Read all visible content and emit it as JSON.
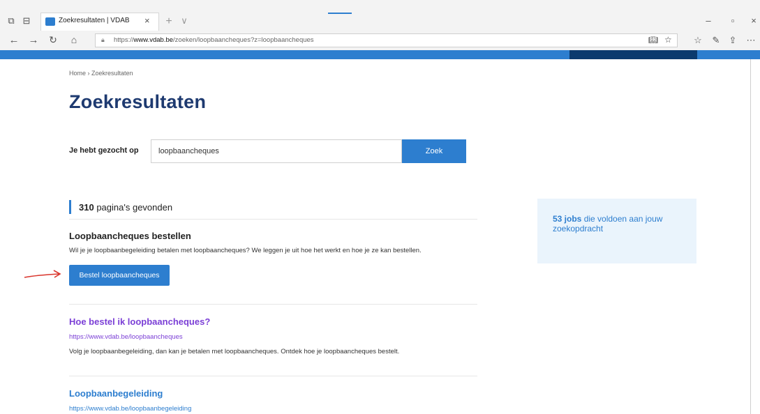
{
  "browser": {
    "tab_title": "Zoekresultaten | VDAB",
    "tab_close": "×",
    "new_tab": "+",
    "tab_menu": "∨",
    "url_prefix": "https://",
    "url_domain": "www.vdab.be",
    "url_path": "/zoeken/loopbaancheques?z=loopbaancheques",
    "window_controls": [
      "–",
      "▫",
      "×"
    ]
  },
  "page": {
    "breadcrumb": "Home  ›  Zoekresultaten",
    "title": "Zoekresultaten",
    "search": {
      "label": "Je hebt gezocht op",
      "value": "loopbaancheques",
      "button": "Zoek"
    },
    "results_count": "310",
    "results_suffix": "pagina's gevonden",
    "results": [
      {
        "title": "Loopbaancheques bestellen",
        "description": "Wil je je loopbaanbegeleiding betalen met loopbaancheques? We leggen je uit hoe het werkt en hoe je ze kan bestellen.",
        "button": "Bestel loopbaancheques"
      },
      {
        "title": "Hoe bestel ik loopbaancheques?",
        "url": "https://www.vdab.be/loopbaancheques",
        "description": "Volg je loopbaanbegeleiding, dan kan je betalen met loopbaancheques. Ontdek hoe je loopbaancheques bestelt."
      },
      {
        "title": "Loopbaanbegeleiding",
        "url": "https://www.vdab.be/loopbaanbegeleiding"
      }
    ],
    "jobs": {
      "count": "53 jobs",
      "text": " die voldoen aan jouw zoekopdracht"
    }
  },
  "colors": {
    "brand_blue": "#2d7ecf",
    "dark_blue": "#1e3a70",
    "visited_purple": "#7b3fd6",
    "annotation_red": "#d9342b"
  }
}
